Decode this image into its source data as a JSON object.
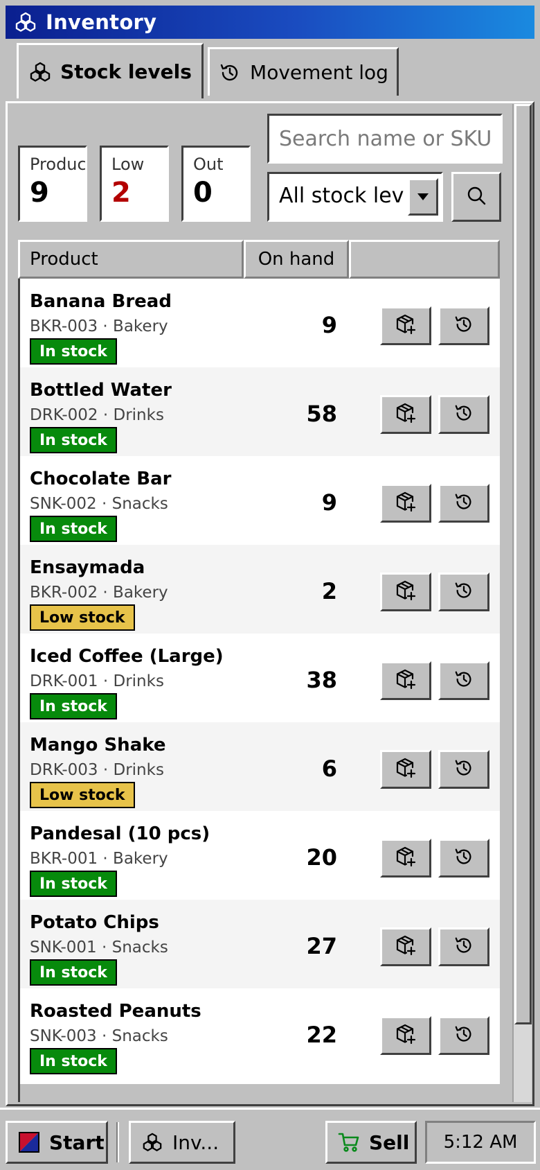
{
  "window": {
    "title": "Inventory",
    "icon": "boxes-icon"
  },
  "tabs": [
    {
      "label": "Stock levels",
      "icon": "boxes-icon",
      "active": true
    },
    {
      "label": "Movement log",
      "icon": "history-icon",
      "active": false
    }
  ],
  "stats": {
    "products": {
      "label": "Products",
      "value": "9"
    },
    "low": {
      "label": "Low",
      "value": "2"
    },
    "out": {
      "label": "Out",
      "value": "0"
    }
  },
  "search": {
    "placeholder": "Search name or SKU",
    "value": ""
  },
  "filter": {
    "selected": "All stock levels"
  },
  "table": {
    "headers": {
      "product": "Product",
      "on_hand": "On hand",
      "actions": ""
    },
    "rows": [
      {
        "name": "Banana Bread",
        "sku": "BKR-003",
        "category": "Bakery",
        "qty": "9",
        "status": "In stock"
      },
      {
        "name": "Bottled Water",
        "sku": "DRK-002",
        "category": "Drinks",
        "qty": "58",
        "status": "In stock"
      },
      {
        "name": "Chocolate Bar",
        "sku": "SNK-002",
        "category": "Snacks",
        "qty": "9",
        "status": "In stock"
      },
      {
        "name": "Ensaymada",
        "sku": "BKR-002",
        "category": "Bakery",
        "qty": "2",
        "status": "Low stock"
      },
      {
        "name": "Iced Coffee (Large)",
        "sku": "DRK-001",
        "category": "Drinks",
        "qty": "38",
        "status": "In stock"
      },
      {
        "name": "Mango Shake",
        "sku": "DRK-003",
        "category": "Drinks",
        "qty": "6",
        "status": "Low stock"
      },
      {
        "name": "Pandesal (10 pcs)",
        "sku": "BKR-001",
        "category": "Bakery",
        "qty": "20",
        "status": "In stock"
      },
      {
        "name": "Potato Chips",
        "sku": "SNK-001",
        "category": "Snacks",
        "qty": "27",
        "status": "In stock"
      },
      {
        "name": "Roasted Peanuts",
        "sku": "SNK-003",
        "category": "Snacks",
        "qty": "22",
        "status": "In stock"
      }
    ]
  },
  "taskbar": {
    "start_label": "Start",
    "app_label": "Inv...",
    "sell_label": "Sell",
    "clock": "5:12 AM"
  },
  "colors": {
    "in_stock": "#078a0c",
    "low_stock": "#e7c34a",
    "low_value": "#b30000",
    "title_bar": "#0a1f8f",
    "sell_icon": "#0a8a1c"
  }
}
